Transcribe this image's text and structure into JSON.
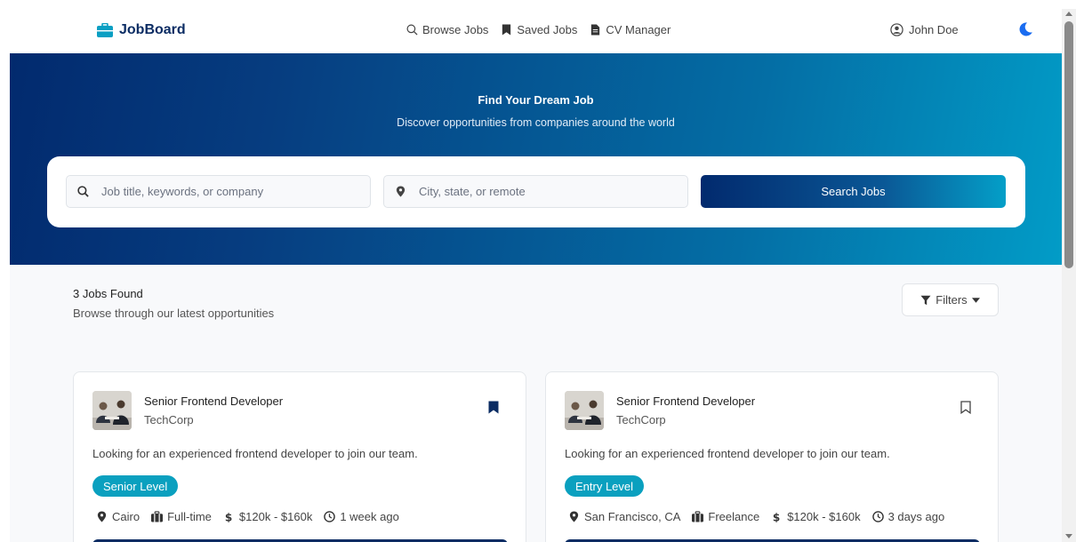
{
  "colors": {
    "brand": "#0b2c63",
    "accent": "#0aa0bf",
    "moon": "#1a6cf0",
    "hero_start": "#022a6e",
    "hero_end": "#029cc7"
  },
  "navbar": {
    "brand": "JobBoard",
    "brand_icon": "briefcase-icon",
    "links": [
      {
        "label": "Browse Jobs",
        "icon": "search-icon"
      },
      {
        "label": "Saved Jobs",
        "icon": "bookmark-icon"
      },
      {
        "label": "CV Manager",
        "icon": "file-icon"
      }
    ],
    "user_name": "John Doe",
    "theme_icon": "moon-icon"
  },
  "hero": {
    "title": "Find Your Dream Job",
    "subtitle": "Discover opportunities from companies around the world",
    "keyword_placeholder": "Job title, keywords, or company",
    "location_placeholder": "City, state, or remote",
    "search_button": "Search Jobs"
  },
  "results": {
    "count_text": "3 Jobs Found",
    "subtitle": "Browse through our latest opportunities",
    "filters_label": "Filters"
  },
  "jobs": [
    {
      "title": "Senior Frontend Developer",
      "company": "TechCorp",
      "description": "Looking for an experienced frontend developer to join our team.",
      "level": "Senior Level",
      "location": "Cairo",
      "type": "Full-time",
      "salary": "$120k - $160k",
      "posted": "1 week ago",
      "saved": true
    },
    {
      "title": "Senior Frontend Developer",
      "company": "TechCorp",
      "description": "Looking for an experienced frontend developer to join our team.",
      "level": "Entry Level",
      "location": "San Francisco, CA",
      "type": "Freelance",
      "salary": "$120k - $160k",
      "posted": "3 days ago",
      "saved": false
    }
  ]
}
